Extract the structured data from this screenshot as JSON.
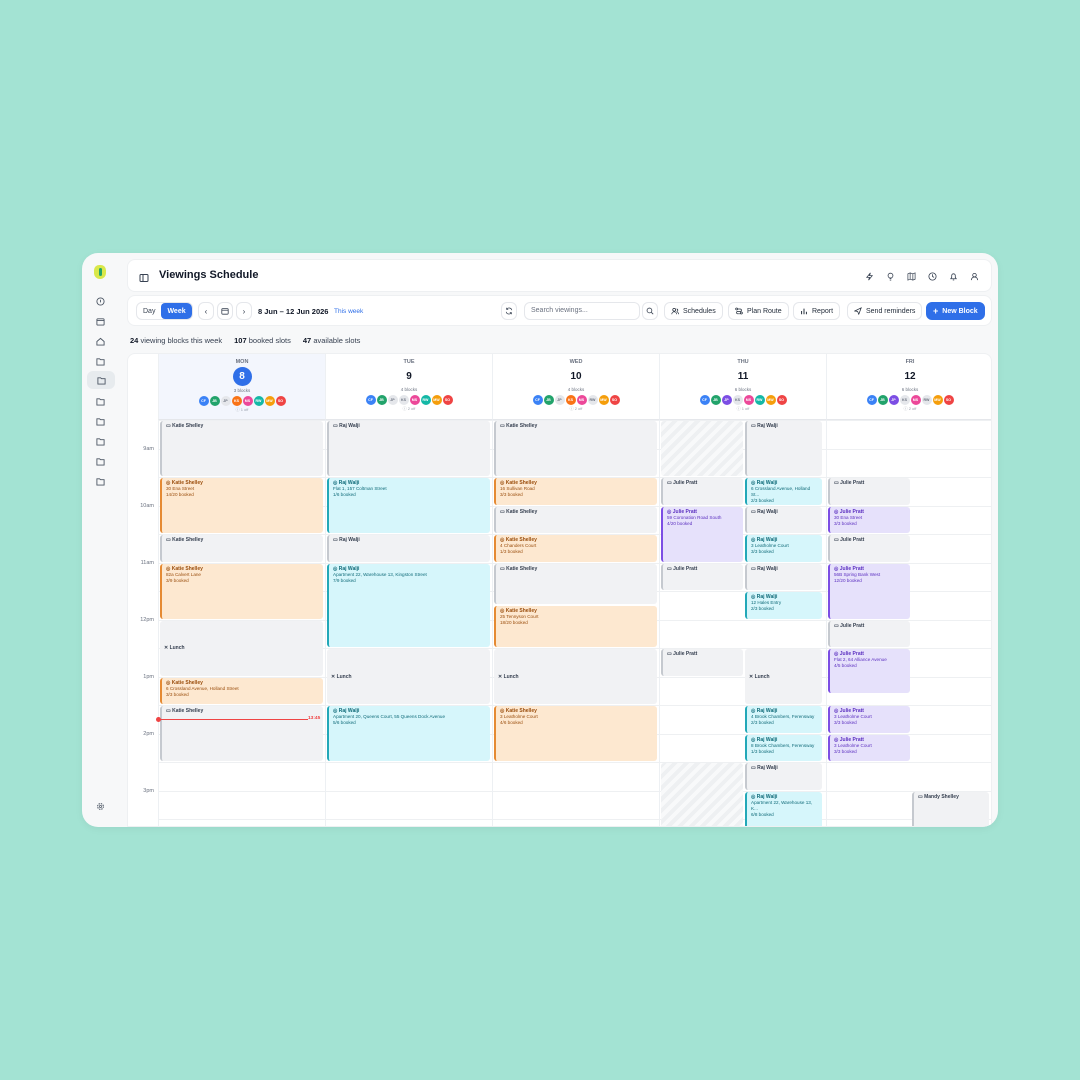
{
  "app": {
    "title": "Viewings Schedule"
  },
  "toolbar": {
    "view_day": "Day",
    "view_week": "Week",
    "range": "8 Jun – 12 Jun 2026",
    "this_week": "This week",
    "search_placeholder": "Search viewings...",
    "schedules": "Schedules",
    "plan_route": "Plan Route",
    "report": "Report",
    "send_reminders": "Send reminders",
    "new_block": "New Block"
  },
  "stats": {
    "blocks_n": "24",
    "blocks_l": "viewing blocks this week",
    "booked_n": "107",
    "booked_l": "booked slots",
    "avail_n": "47",
    "avail_l": "available slots"
  },
  "colors": {
    "accent": "#2f6fe8",
    "orange": "#e58a33",
    "cyan": "#22a8b8",
    "purple": "#7c4ee4",
    "grey": "#c5c9cf",
    "now": "#ef4444"
  },
  "hours": [
    "9am",
    "10am",
    "11am",
    "12pm",
    "1pm",
    "2pm",
    "3pm"
  ],
  "now_label": "13:45",
  "days": [
    {
      "dow": "MON",
      "num": "8",
      "blocks": "3 blocks",
      "off": "1 off",
      "today": true,
      "avatars": [
        {
          "t": "CF",
          "c": "#3b82f6"
        },
        {
          "t": "JB",
          "c": "#22a36b"
        },
        {
          "t": "JP",
          "c": "#e5e7eb",
          "d": "#6b7280"
        },
        {
          "t": "KS",
          "c": "#f97316"
        },
        {
          "t": "MS",
          "c": "#ec4899"
        },
        {
          "t": "RW",
          "c": "#14b8a6"
        },
        {
          "t": "MW",
          "c": "#f59e0b"
        },
        {
          "t": "SO",
          "c": "#ef4444"
        }
      ]
    },
    {
      "dow": "TUE",
      "num": "9",
      "blocks": "4 blocks",
      "off": "2 off",
      "avatars": [
        {
          "t": "CF",
          "c": "#3b82f6"
        },
        {
          "t": "JB",
          "c": "#22a36b"
        },
        {
          "t": "JP",
          "c": "#e5e7eb",
          "d": "#6b7280"
        },
        {
          "t": "KS",
          "c": "#e5e7eb",
          "d": "#6b7280"
        },
        {
          "t": "MS",
          "c": "#ec4899"
        },
        {
          "t": "RW",
          "c": "#14b8a6"
        },
        {
          "t": "MW",
          "c": "#f59e0b"
        },
        {
          "t": "SO",
          "c": "#ef4444"
        }
      ]
    },
    {
      "dow": "WED",
      "num": "10",
      "blocks": "4 blocks",
      "off": "2 off",
      "avatars": [
        {
          "t": "CF",
          "c": "#3b82f6"
        },
        {
          "t": "JB",
          "c": "#22a36b"
        },
        {
          "t": "JP",
          "c": "#e5e7eb",
          "d": "#6b7280"
        },
        {
          "t": "KS",
          "c": "#f97316"
        },
        {
          "t": "MS",
          "c": "#ec4899"
        },
        {
          "t": "RW",
          "c": "#e5e7eb",
          "d": "#6b7280"
        },
        {
          "t": "MW",
          "c": "#f59e0b"
        },
        {
          "t": "SO",
          "c": "#ef4444"
        }
      ]
    },
    {
      "dow": "THU",
      "num": "11",
      "blocks": "6 blocks",
      "off": "1 off",
      "avatars": [
        {
          "t": "CF",
          "c": "#3b82f6"
        },
        {
          "t": "JB",
          "c": "#22a36b"
        },
        {
          "t": "JP",
          "c": "#7c4ee4"
        },
        {
          "t": "KS",
          "c": "#e5e7eb",
          "d": "#6b7280"
        },
        {
          "t": "MS",
          "c": "#ec4899"
        },
        {
          "t": "RW",
          "c": "#14b8a6"
        },
        {
          "t": "MW",
          "c": "#f59e0b"
        },
        {
          "t": "SO",
          "c": "#ef4444"
        }
      ]
    },
    {
      "dow": "FRI",
      "num": "12",
      "blocks": "6 blocks",
      "off": "2 off",
      "avatars": [
        {
          "t": "CF",
          "c": "#3b82f6"
        },
        {
          "t": "JB",
          "c": "#22a36b"
        },
        {
          "t": "JP",
          "c": "#7c4ee4"
        },
        {
          "t": "KS",
          "c": "#e5e7eb",
          "d": "#6b7280"
        },
        {
          "t": "MS",
          "c": "#ec4899"
        },
        {
          "t": "RW",
          "c": "#e5e7eb",
          "d": "#6b7280"
        },
        {
          "t": "MW",
          "c": "#f59e0b"
        },
        {
          "t": "SO",
          "c": "#ef4444"
        }
      ]
    }
  ],
  "events": [
    {
      "k": "g",
      "n": "Katie Shelley"
    },
    {
      "k": "o",
      "n": "Katie Shelley",
      "a": "30 Ena Street",
      "b": "14/20 booked"
    },
    {
      "k": "g",
      "n": "Katie Shelley"
    },
    {
      "k": "o",
      "n": "Katie Shelley",
      "a": "82a Calvert Lane",
      "b": "3/9 booked"
    },
    {
      "k": "l",
      "n": "Lunch"
    },
    {
      "k": "o",
      "n": "Katie Shelley",
      "a": "6 Crossland Avenue, Holland Street",
      "b": "3/3 booked"
    },
    {
      "k": "g",
      "n": "Katie Shelley"
    },
    {
      "k": "g",
      "n": "Raj Walji"
    },
    {
      "k": "c",
      "n": "Raj Walji",
      "a": "Flat 1, 157 Coltman Street",
      "b": "1/6 booked"
    },
    {
      "k": "g",
      "n": "Raj Walji"
    },
    {
      "k": "c",
      "n": "Raj Walji",
      "a": "Apartment 22, Warehouse 13, Kingston Street",
      "b": "7/9 booked"
    },
    {
      "k": "l",
      "n": "Lunch"
    },
    {
      "k": "c",
      "n": "Raj Walji",
      "a": "Apartment 20, Queens Court, 55 Queens Dock Avenue",
      "b": "5/6 booked"
    },
    {
      "k": "g",
      "n": "Katie Shelley"
    },
    {
      "k": "o",
      "n": "Katie Shelley",
      "a": "16 Sullivan Road",
      "b": "3/3 booked"
    },
    {
      "k": "g",
      "n": "Katie Shelley"
    },
    {
      "k": "o",
      "n": "Katie Shelley",
      "a": "4 Chanders Court",
      "b": "1/3 booked"
    },
    {
      "k": "g",
      "n": "Katie Shelley"
    },
    {
      "k": "o",
      "n": "Katie Shelley",
      "a": "25 Tennyson Court",
      "b": "18/20 booked"
    },
    {
      "k": "l",
      "n": "Lunch"
    },
    {
      "k": "o",
      "n": "Katie Shelley",
      "a": "3 Leatholme Court",
      "b": "4/6 booked"
    },
    {
      "k": "h"
    },
    {
      "k": "g",
      "n": "Julie Pratt"
    },
    {
      "k": "p",
      "n": "Julie Pratt",
      "a": "59 Coronation Road South",
      "b": "4/20 booked"
    },
    {
      "k": "g",
      "n": "Julie Pratt"
    },
    {
      "k": "g",
      "n": "Julie Pratt"
    },
    {
      "k": "h"
    },
    {
      "k": "g",
      "n": "Raj Walji"
    },
    {
      "k": "c",
      "n": "Raj Walji",
      "a": "6 Crossland Avenue, Holland St...",
      "b": "2/3 booked"
    },
    {
      "k": "g",
      "n": "Raj Walji"
    },
    {
      "k": "c",
      "n": "Raj Walji",
      "a": "3 Leatholme Court",
      "b": "3/3 booked"
    },
    {
      "k": "g",
      "n": "Raj Walji"
    },
    {
      "k": "c",
      "n": "Raj Walji",
      "a": "12 Hales Entry",
      "b": "2/3 booked"
    },
    {
      "k": "l",
      "n": "Lunch"
    },
    {
      "k": "c",
      "n": "Raj Walji",
      "a": "4 Brook Chambers, Ferensway",
      "b": "2/3 booked"
    },
    {
      "k": "c",
      "n": "Raj Walji",
      "a": "8 Brook Chambers, Ferensway",
      "b": "1/3 booked"
    },
    {
      "k": "g",
      "n": "Raj Walji"
    },
    {
      "k": "c",
      "n": "Raj Walji",
      "a": "Apartment 22, Warehouse 13, K...",
      "b": "6/8 booked"
    },
    {
      "k": "g",
      "n": "Julie Pratt"
    },
    {
      "k": "p",
      "n": "Julie Pratt",
      "a": "30 Ena Street",
      "b": "3/3 booked"
    },
    {
      "k": "g",
      "n": "Julie Pratt"
    },
    {
      "k": "p",
      "n": "Julie Pratt",
      "a": "56B Spring Bank West",
      "b": "12/20 booked"
    },
    {
      "k": "g",
      "n": "Julie Pratt"
    },
    {
      "k": "p",
      "n": "Julie Pratt",
      "a": "Flat 2, 64 Alliance Avenue",
      "b": "4/5 booked"
    },
    {
      "k": "p",
      "n": "Julie Pratt",
      "a": "3 Leatholme Court",
      "b": "3/3 booked"
    },
    {
      "k": "p",
      "n": "Julie Pratt",
      "a": "3 Leatholme Court",
      "b": "3/3 booked"
    },
    {
      "k": "g",
      "n": "Mandy Shelley"
    }
  ]
}
